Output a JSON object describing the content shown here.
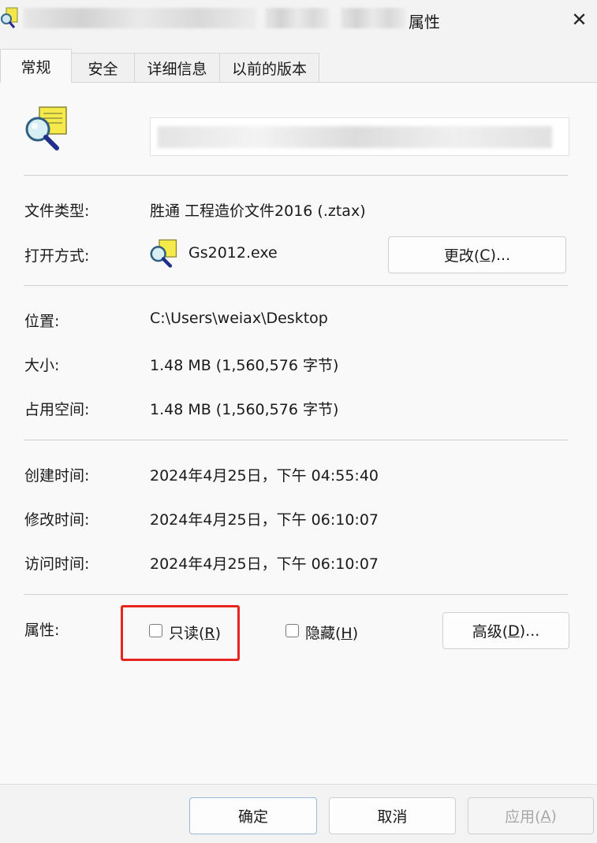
{
  "window": {
    "title": "属性",
    "close_glyph": "✕"
  },
  "tabs": [
    {
      "label": "常规",
      "active": true
    },
    {
      "label": "安全",
      "active": false
    },
    {
      "label": "详细信息",
      "active": false
    },
    {
      "label": "以前的版本",
      "active": false
    }
  ],
  "general": {
    "file_type_label": "文件类型:",
    "file_type_value": "胜通 工程造价文件2016 (.ztax)",
    "open_with_label": "打开方式:",
    "open_with_value": "Gs2012.exe",
    "change_button": {
      "pre": "更改(",
      "key": "C",
      "post": ")..."
    },
    "location_label": "位置:",
    "location_value": "C:\\Users\\weiax\\Desktop",
    "size_label": "大小:",
    "size_value": "1.48 MB (1,560,576 字节)",
    "size_on_disk_label": "占用空间:",
    "size_on_disk_value": "1.48 MB (1,560,576 字节)",
    "created_label": "创建时间:",
    "created_value": "2024年4月25日，下午 04:55:40",
    "modified_label": "修改时间:",
    "modified_value": "2024年4月25日，下午 06:10:07",
    "accessed_label": "访问时间:",
    "accessed_value": "2024年4月25日，下午 06:10:07",
    "attributes_label": "属性:",
    "readonly": {
      "pre": "只读(",
      "key": "R",
      "post": ")",
      "checked": false
    },
    "hidden": {
      "pre": "隐藏(",
      "key": "H",
      "post": ")",
      "checked": false
    },
    "advanced_button": {
      "pre": "高级(",
      "key": "D",
      "post": ")..."
    }
  },
  "footer": {
    "ok": "确定",
    "cancel": "取消",
    "apply": {
      "pre": "应用(",
      "key": "A",
      "post": ")",
      "disabled": true
    }
  },
  "colors": {
    "highlight": "#e8261f",
    "panel": "#f9f9f9",
    "window": "#f3f3f3"
  },
  "icons": {
    "file_icon": "magnifier-document-icon",
    "app_icon": "magnifier-document-icon"
  }
}
